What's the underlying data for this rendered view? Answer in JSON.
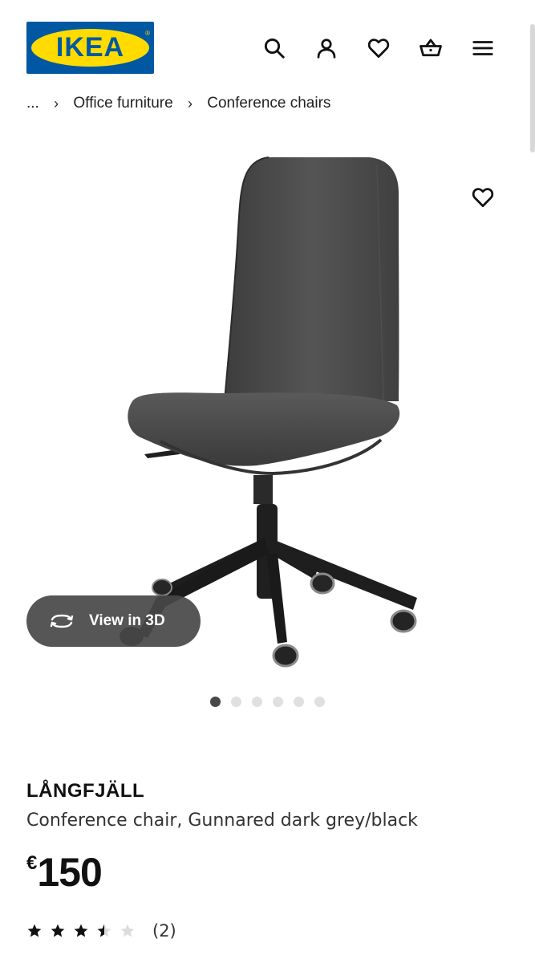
{
  "header": {
    "logo_text": "IKEA",
    "logo_registered": "®",
    "icons": [
      "search-icon",
      "user-icon",
      "heart-icon",
      "basket-icon",
      "menu-icon"
    ]
  },
  "breadcrumb": {
    "ellipsis": "...",
    "items": [
      "Office furniture",
      "Conference chairs"
    ]
  },
  "product": {
    "name": "LÅNGFJÄLL",
    "description": "Conference chair, Gunnared dark grey/black",
    "currency": "€",
    "price": "150",
    "rating_value": 3.5,
    "rating_max": 5,
    "review_count": "(2)"
  },
  "gallery": {
    "view_3d_label": "View in 3D",
    "image_count": 6,
    "active_index": 0
  },
  "colors": {
    "ikea_blue": "#0058a3",
    "ikea_yellow": "#ffdb00",
    "chair_fabric": "#4a4a4a",
    "chair_base": "#1f1f1f"
  }
}
